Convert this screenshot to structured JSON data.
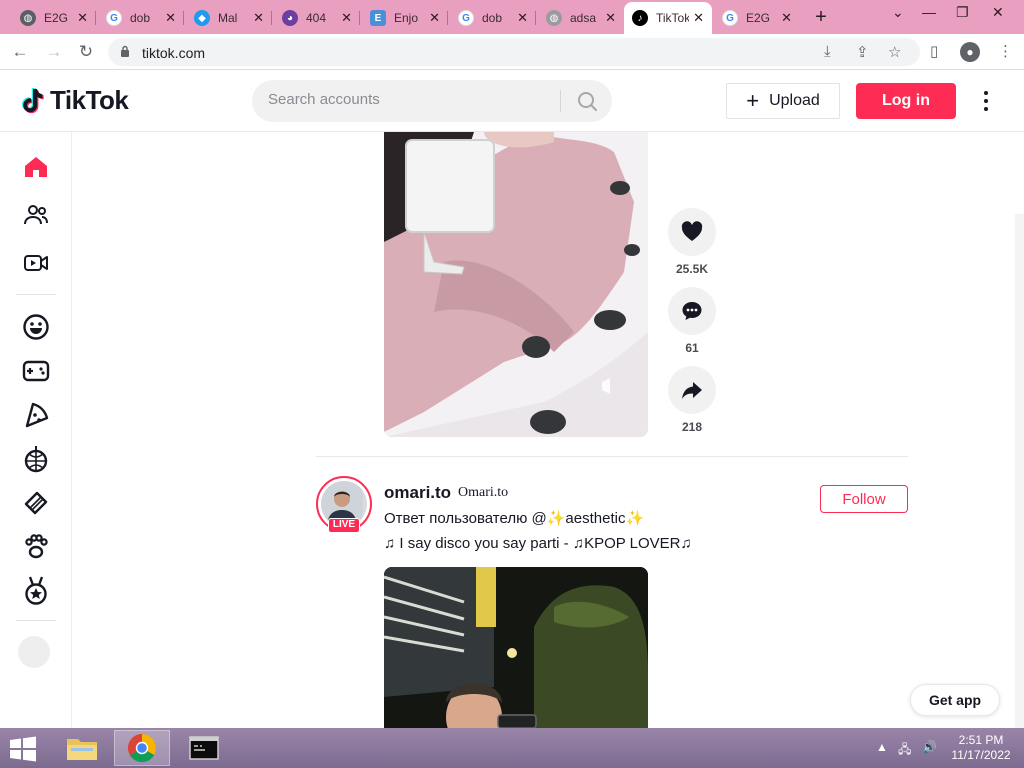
{
  "browser": {
    "tabs": [
      {
        "title": "E2G",
        "icon": "globe-icon",
        "color": "#5a5f66"
      },
      {
        "title": "dob",
        "icon": "google-icon",
        "color": "#4285f4"
      },
      {
        "title": "Mal",
        "icon": "twitter-icon",
        "color": "#1d9bf0"
      },
      {
        "title": "404",
        "icon": "app-icon",
        "color": "#6b3fa0"
      },
      {
        "title": "Enjo",
        "icon": "doc-icon",
        "color": "#4a90d9"
      },
      {
        "title": "dob",
        "icon": "google-icon",
        "color": "#4285f4"
      },
      {
        "title": "adsa",
        "icon": "globe-icon",
        "color": "#9a9aa0"
      },
      {
        "title": "TikTok",
        "icon": "tiktok-icon",
        "color": "#000000"
      },
      {
        "title": "E2G",
        "icon": "google-icon",
        "color": "#4285f4"
      }
    ],
    "url": "tiktok.com"
  },
  "tiktok": {
    "logo_text": "TikTok",
    "search_placeholder": "Search accounts",
    "upload_label": "Upload",
    "login_label": "Log in",
    "brand_color": "#fe2c55"
  },
  "sidebar": {
    "items": [
      "home-icon",
      "following-icon",
      "live-icon",
      "comedy-icon",
      "gaming-icon",
      "food-icon",
      "dance-icon",
      "beauty-icon",
      "animals-icon",
      "sports-icon"
    ]
  },
  "video1": {
    "likes": "25.5K",
    "comments": "61",
    "shares": "218"
  },
  "post": {
    "username": "omari.to",
    "nickname": "Omari.to",
    "live_badge": "LIVE",
    "caption": "Ответ пользователю @✨aesthetic✨",
    "music": "♫  I say disco you say parti - ♫KPOP LOVER♫",
    "follow_label": "Follow"
  },
  "get_app_label": "Get app",
  "taskbar": {
    "time": "2:51 PM",
    "date": "11/17/2022"
  }
}
